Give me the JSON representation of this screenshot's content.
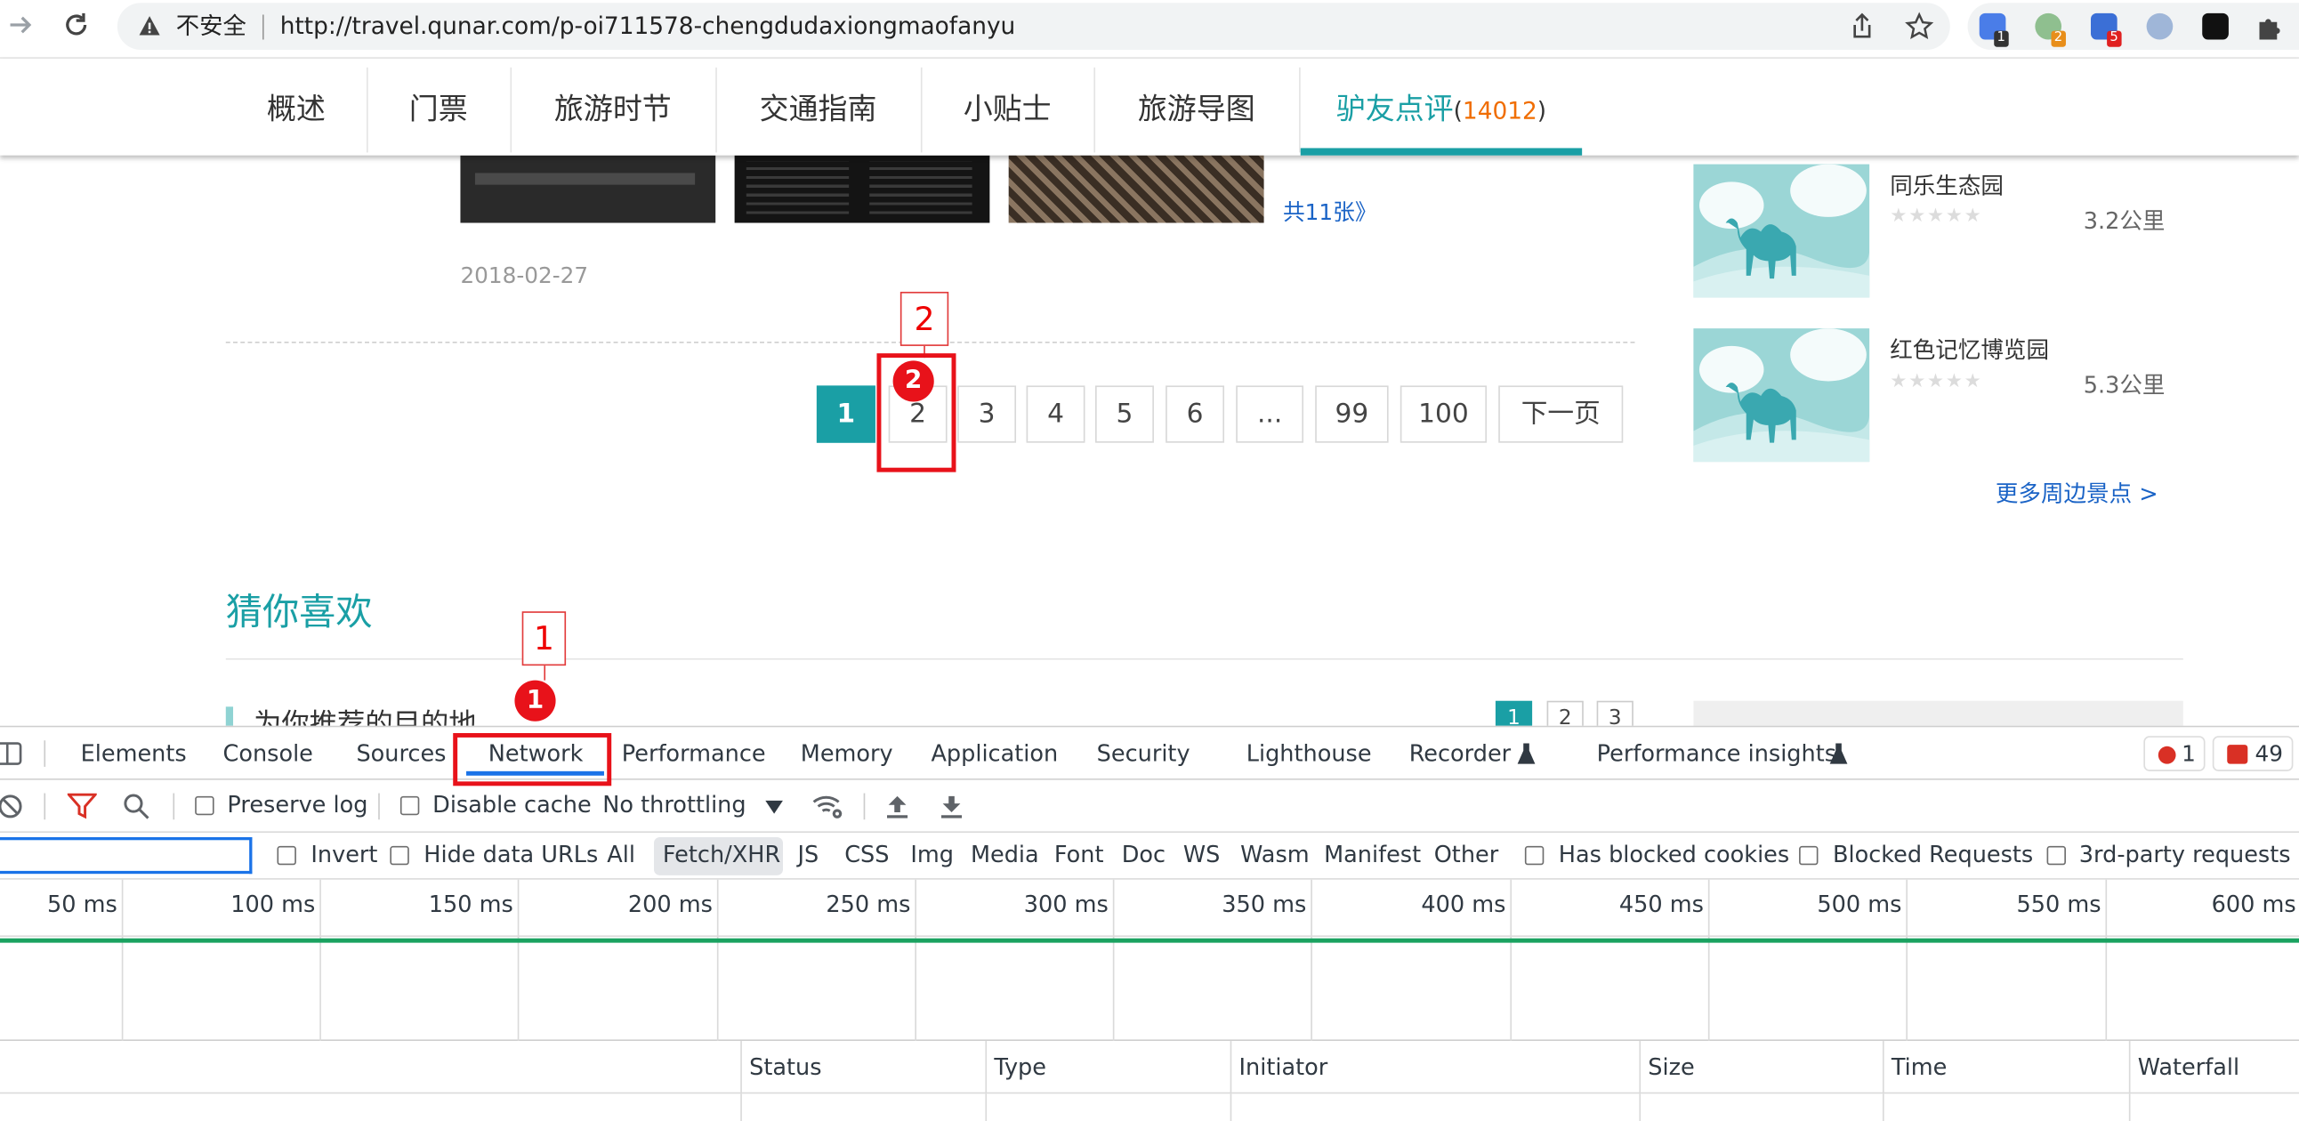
{
  "browser": {
    "security_label": "不安全",
    "url": "http://travel.qunar.com/p-oi711578-chengdudaxiongmaofanyu",
    "extension_badges": [
      "1",
      "2",
      "5"
    ]
  },
  "site_nav": {
    "items": [
      "概述",
      "门票",
      "旅游时节",
      "交通指南",
      "小贴士",
      "旅游导图"
    ],
    "active_label": "驴友点评",
    "active_count": "14012",
    "paren_open": "(",
    "paren_close": ")"
  },
  "review": {
    "photo_count_link": "共11张》",
    "date": "2018-02-27"
  },
  "pagination": {
    "pages": [
      "1",
      "2",
      "3",
      "4",
      "5",
      "6",
      "...",
      "99",
      "100"
    ],
    "next_label": "下一页",
    "current": "1"
  },
  "nearby": {
    "items": [
      {
        "name": "同乐生态园",
        "distance": "3.2公里"
      },
      {
        "name": "红色记忆博览园",
        "distance": "5.3公里"
      }
    ],
    "stars": "★★★★★",
    "more_link": "更多周边景点 >"
  },
  "recommend": {
    "title": "猜你喜欢",
    "subtitle": "为你推荐的目的地",
    "pages": [
      "1",
      "2",
      "3"
    ]
  },
  "devtools": {
    "tabs": [
      "Elements",
      "Console",
      "Sources",
      "Network",
      "Performance",
      "Memory",
      "Application",
      "Security",
      "Lighthouse",
      "Recorder",
      "Performance insights"
    ],
    "active_tab": "Network",
    "error_count": "1",
    "issue_count": "49",
    "toolbar": {
      "preserve_log": "Preserve log",
      "disable_cache": "Disable cache",
      "throttling": "No throttling"
    },
    "filters": {
      "invert": "Invert",
      "hide_data_urls": "Hide data URLs",
      "types": [
        "All",
        "Fetch/XHR",
        "JS",
        "CSS",
        "Img",
        "Media",
        "Font",
        "Doc",
        "WS",
        "Wasm",
        "Manifest",
        "Other"
      ],
      "active_type": "Fetch/XHR",
      "has_blocked_cookies": "Has blocked cookies",
      "blocked_requests": "Blocked Requests",
      "third_party": "3rd-party requests"
    },
    "timeline_labels": [
      "50 ms",
      "100 ms",
      "150 ms",
      "200 ms",
      "250 ms",
      "300 ms",
      "350 ms",
      "400 ms",
      "450 ms",
      "500 ms",
      "550 ms",
      "600 ms"
    ],
    "columns": [
      "Status",
      "Type",
      "Initiator",
      "Size",
      "Time",
      "Waterfall"
    ]
  },
  "annotations": [
    {
      "number": "1",
      "label": "1"
    },
    {
      "number": "2",
      "label": "2"
    }
  ],
  "colors": {
    "accent_teal": "#1a9fa5",
    "count_orange": "#f06d00",
    "link_blue": "#1a63c6",
    "annotation_red": "#e8121a",
    "devtools_blue": "#1a73e8"
  }
}
